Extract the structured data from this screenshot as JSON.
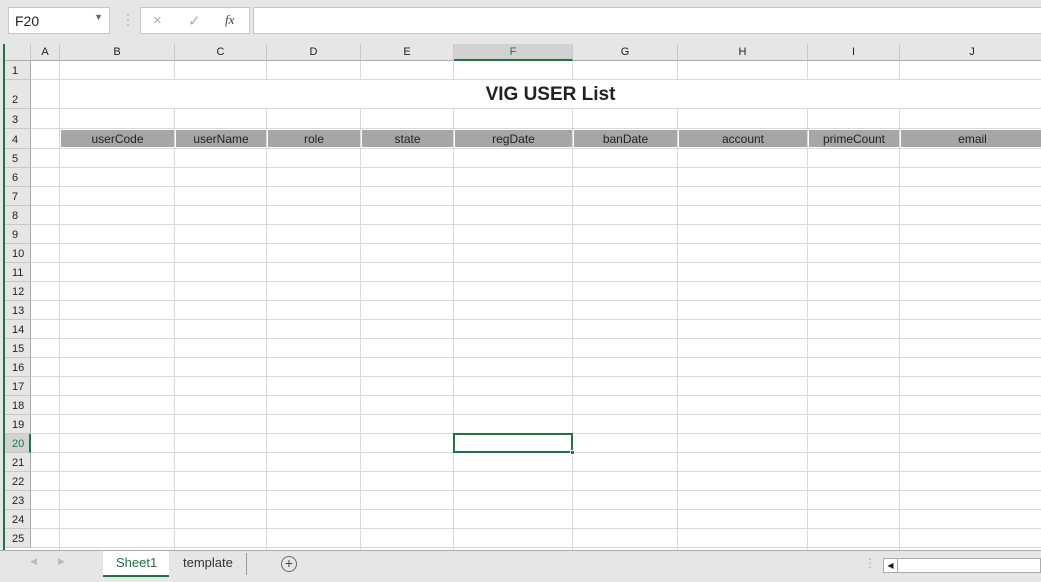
{
  "name_box": {
    "value": "F20",
    "dropdown_icon": "chevron-down-icon"
  },
  "formula_bar": {
    "cancel_icon": "×",
    "enter_icon": "✓",
    "fx_label": "fx",
    "value": ""
  },
  "columns": [
    "A",
    "B",
    "C",
    "D",
    "E",
    "F",
    "G",
    "H",
    "I",
    "J"
  ],
  "selected_column": "F",
  "rows": [
    "1",
    "2",
    "3",
    "4",
    "5",
    "6",
    "7",
    "8",
    "9",
    "10",
    "11",
    "12",
    "13",
    "14",
    "15",
    "16",
    "17",
    "18",
    "19",
    "20",
    "21",
    "22",
    "23",
    "24",
    "25"
  ],
  "selected_row": "20",
  "title": "VIG USER List",
  "headers": [
    "userCode",
    "userName",
    "role",
    "state",
    "regDate",
    "banDate",
    "account",
    "primeCount",
    "email"
  ],
  "header_fill": "#a6a6a6",
  "accent": "#217346",
  "tabs": [
    {
      "label": "Sheet1",
      "active": true
    },
    {
      "label": "template",
      "active": false
    }
  ],
  "add_sheet_icon": "+",
  "nav_left": "◀",
  "nav_right": "▶",
  "scroll_left": "◀"
}
